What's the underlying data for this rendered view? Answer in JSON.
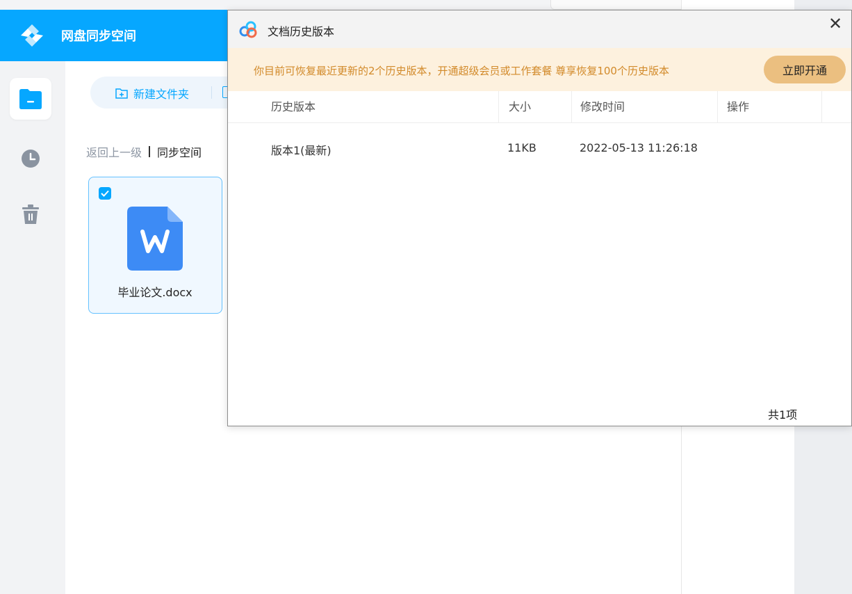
{
  "app": {
    "title": "网盘同步空间"
  },
  "toolbar": {
    "new_folder_label": "新建文件夹"
  },
  "breadcrumb": {
    "back_label": "返回上一级",
    "current": "同步空间"
  },
  "files": [
    {
      "name": "毕业论文.docx",
      "type": "word",
      "checked": true
    }
  ],
  "dialog": {
    "title": "文档历史版本",
    "close_glyph": "✕",
    "banner": {
      "text": "你目前可恢复最近更新的2个历史版本，开通超级会员或工作套餐 尊享恢复100个历史版本",
      "button_label": "立即开通"
    },
    "table": {
      "columns": [
        "历史版本",
        "大小",
        "修改时间",
        "操作"
      ],
      "rows": [
        {
          "version": "版本1(最新)",
          "size": "11KB",
          "modified": "2022-05-13 11:26:18",
          "action": ""
        }
      ]
    },
    "total_label": "共1项"
  },
  "colors": {
    "brand": "#06a7ff",
    "banner_bg": "#fdf1de",
    "banner_text": "#d28a2a",
    "upgrade_button": "#ebbf80"
  },
  "icons": {
    "logo": "sync-logo-icon",
    "sidebar": [
      "folder-icon",
      "clock-icon",
      "trash-icon"
    ],
    "dialog": "baidu-cloud-icon"
  }
}
